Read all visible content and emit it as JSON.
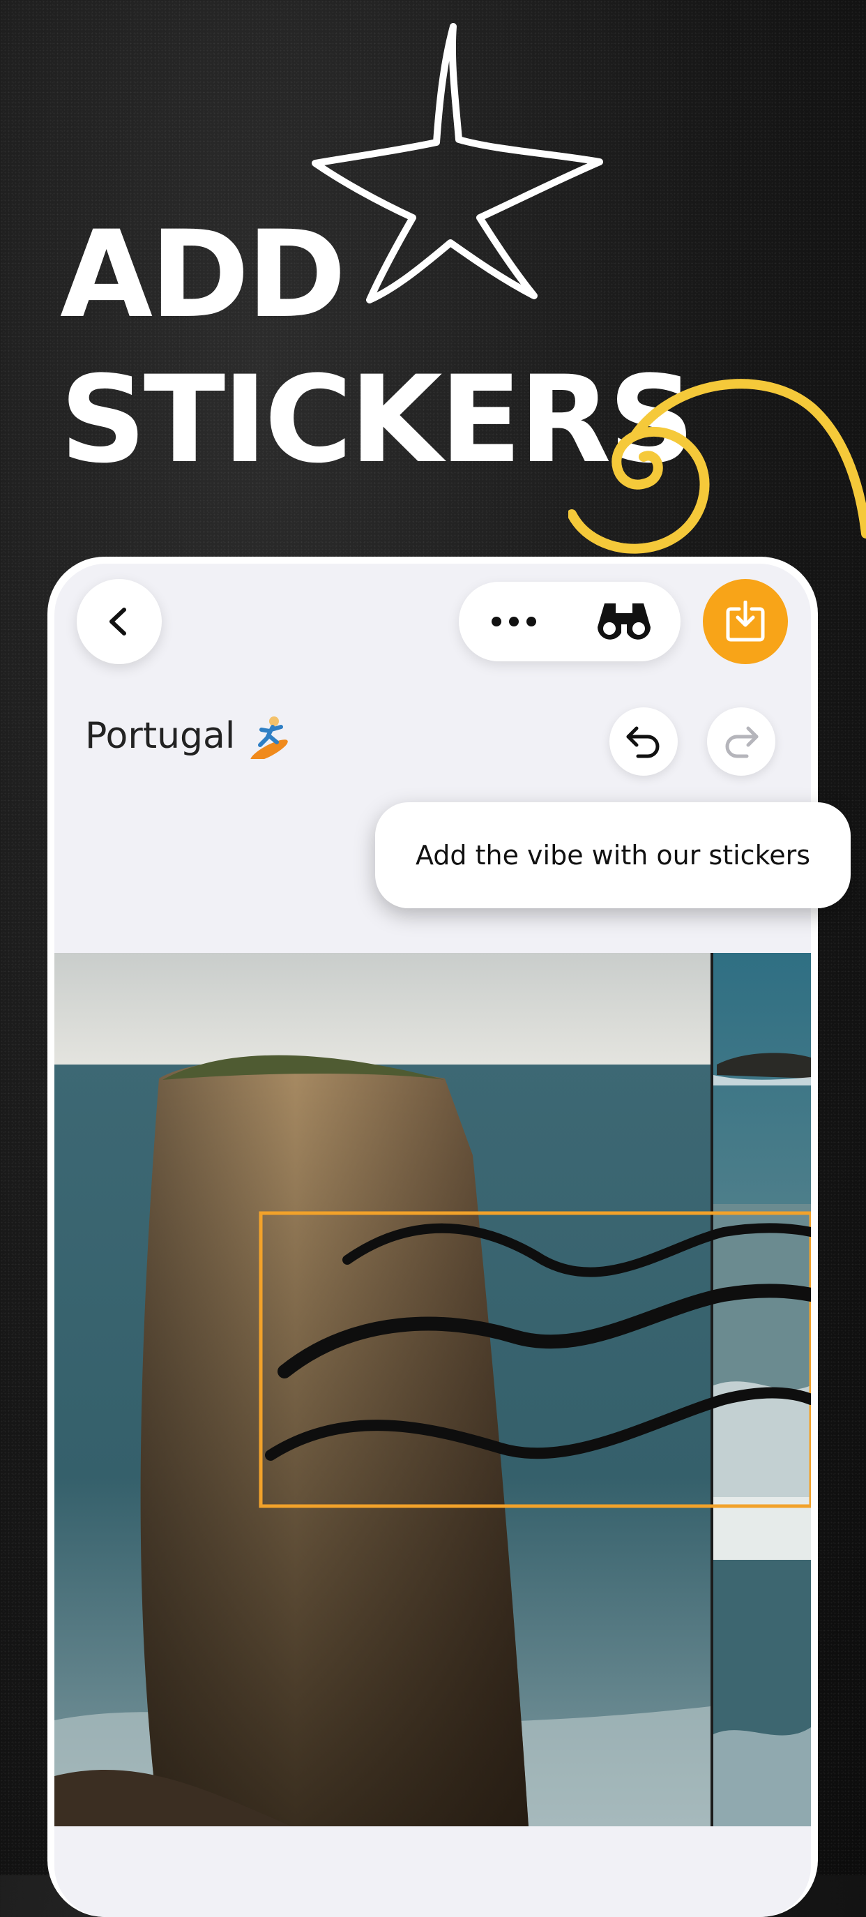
{
  "promo": {
    "headline": "ADD\nSTICKERS"
  },
  "toolbar": {
    "back_icon": "chevron-left-icon",
    "more_icon": "more-horizontal-icon",
    "binoculars_icon": "binoculars-icon",
    "save_icon": "download-tray-icon",
    "accent_color": "#f8a418"
  },
  "album": {
    "title": "Portugal",
    "title_icon": "surfer-emoji"
  },
  "history": {
    "undo_icon": "undo-icon",
    "redo_icon": "redo-icon"
  },
  "tooltip": {
    "text": "Add the vibe with our stickers"
  },
  "canvas": {
    "photos": [
      "sea-stack-photo",
      "coastline-photo",
      "waves-photo",
      "ocean-photo"
    ],
    "sticker": "wavy-lines-sticker",
    "selection_color": "#f2a22a"
  }
}
